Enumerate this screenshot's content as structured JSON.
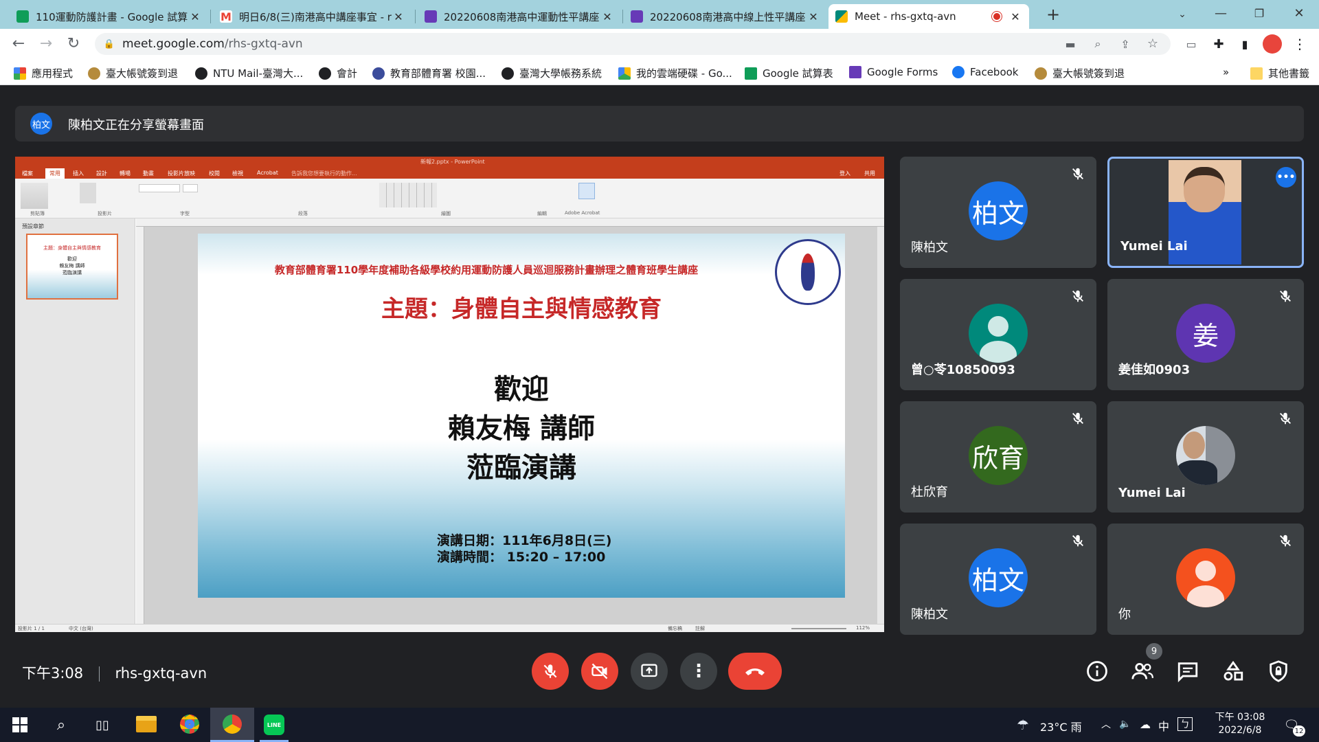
{
  "browser": {
    "tabs": [
      {
        "title": "110運動防護計畫 - Google 試算",
        "icon": "sheets-icon",
        "color": "#0f9d58"
      },
      {
        "title": "明日6/8(三)南港高中講座事宜 - r",
        "icon": "gmail-icon",
        "color": "#ea4335"
      },
      {
        "title": "20220608南港高中運動性平講座",
        "icon": "forms-icon",
        "color": "#673ab7"
      },
      {
        "title": "20220608南港高中線上性平講座",
        "icon": "forms-icon",
        "color": "#673ab7"
      },
      {
        "title": "Meet - rhs-gxtq-avn",
        "icon": "meet-icon",
        "color": "#00897b"
      }
    ],
    "url_host": "meet.google.com",
    "url_path": "/rhs-gxtq-avn",
    "bookmarks": [
      {
        "label": "應用程式",
        "icon": "apps-grid-icon"
      },
      {
        "label": "臺大帳號簽到退",
        "icon": "ntu-seal-icon"
      },
      {
        "label": "NTU Mail-臺灣大...",
        "icon": "globe-icon"
      },
      {
        "label": "會計",
        "icon": "globe-icon"
      },
      {
        "label": "教育部體育署 校園...",
        "icon": "moe-icon"
      },
      {
        "label": "臺灣大學帳務系統",
        "icon": "globe-icon"
      },
      {
        "label": "我的雲端硬碟 - Go...",
        "icon": "drive-icon"
      },
      {
        "label": "Google 試算表",
        "icon": "sheets-icon"
      },
      {
        "label": "Google Forms",
        "icon": "forms-icon"
      },
      {
        "label": "Facebook",
        "icon": "facebook-icon"
      },
      {
        "label": "臺大帳號簽到退",
        "icon": "ntu-seal-icon"
      }
    ],
    "bookmarks_more": "»",
    "other_bookmarks": "其他書籤"
  },
  "meet": {
    "presenter_avatar": "柏文",
    "presenter_banner": "陳柏文正在分享螢幕畫面",
    "time": "下午3:08",
    "meeting_code": "rhs-gxtq-avn",
    "participant_count": "9",
    "participants": [
      {
        "name": "陳柏文",
        "avatar": "柏文",
        "color": "#1a73e8",
        "muted": true
      },
      {
        "name": "Yumei Lai",
        "avatar": "photo",
        "color": "#3d6fd6",
        "muted": false
      },
      {
        "name": "曾○苓10850093",
        "avatar": "person",
        "color": "#00897b",
        "muted": true
      },
      {
        "name": "姜佳如0903",
        "avatar": "姜",
        "color": "#5e35b1",
        "muted": true
      },
      {
        "name": "杜欣育",
        "avatar": "欣育",
        "color": "#33691e",
        "muted": true
      },
      {
        "name": "Yumei Lai",
        "avatar": "photo",
        "color": "#607d8b",
        "muted": true
      },
      {
        "name": "陳柏文",
        "avatar": "柏文",
        "color": "#1a73e8",
        "muted": true
      },
      {
        "name": "你",
        "avatar": "person",
        "color": "#f4511e",
        "muted": true
      }
    ]
  },
  "ppt": {
    "title": "新報2.pptx - PowerPoint",
    "ribbon_tabs": [
      "檔案",
      "常用",
      "插入",
      "設計",
      "轉場",
      "動畫",
      "投影片放映",
      "校閱",
      "檢視",
      "Acrobat"
    ],
    "tell_me": "告訴我您想要執行的動作...",
    "login": "登入",
    "share": "共用",
    "groups": [
      "剪貼簿",
      "投影片",
      "字型",
      "段落",
      "繪圖",
      "編輯",
      "Adobe Acrobat"
    ],
    "thumb_label": "預設章節",
    "status_left": "投影片 1 / 1",
    "status_lang": "中文 (台灣)",
    "status_right": [
      "備忘稿",
      "註解"
    ],
    "zoom": "112%"
  },
  "slide": {
    "header": "教育部體育署110學年度補助各級學校約用運動防護人員巡迴服務計畫辦理之體育班學生講座",
    "theme": "主題：身體自主與情感教育",
    "welcome": "歡迎",
    "speaker": "賴友梅 講師",
    "greeting": "蒞臨演講",
    "date": "演講日期：111年6月8日(三)",
    "time": "演講時間： 15:20 – 17:00",
    "thumb_header": "主題：身體自主與情感教育",
    "thumb_lines": [
      "歡迎",
      "賴友梅 講師",
      "蒞臨演講"
    ]
  },
  "taskbar": {
    "weather": "23°C 雨",
    "ime": "中",
    "clock_time": "下午 03:08",
    "clock_date": "2022/6/8",
    "notifications": "12"
  }
}
